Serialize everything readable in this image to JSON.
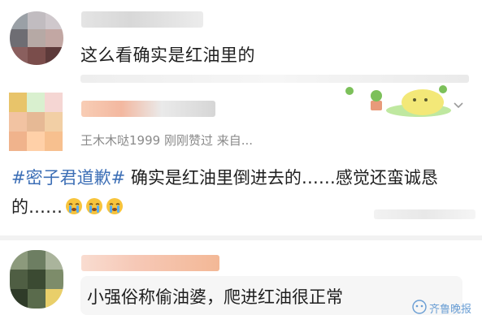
{
  "comments": [
    {
      "avatar_colors": [
        "#9aa0a6",
        "#c1bcc0",
        "#cfc8cc",
        "#6e6d73",
        "#b6a9a5",
        "#c2a7a3",
        "#8a5f5e",
        "#7a4d4b",
        "#5d3a3a"
      ],
      "text": "这么看确实是红油里的"
    },
    {
      "avatar_colors": [
        "#e8c46a",
        "#d9f0cf",
        "#f5d6d3",
        "#f2c3a2",
        "#e6b995",
        "#f2cfa5",
        "#f0b38c",
        "#ffd0a8",
        "#f7c08f"
      ],
      "user_line": "王木木哒1999  刚刚赞过  来自...",
      "hashtag": "#密子君道歉#",
      "body": " 确实是红油里倒进去的……感觉还蛮诚恳的……",
      "emoji_names": [
        "crying-face-icon",
        "crying-face-icon",
        "crying-face-icon"
      ]
    },
    {
      "avatar_colors": [
        "#8c9a7c",
        "#6d7e62",
        "#aab49c",
        "#4f5e43",
        "#3b4a32",
        "#7d8c6a",
        "#2f3b29",
        "#5a6b4c",
        "#e9cf6a"
      ],
      "text": "小强俗称偷油婆，爬进红油很正常"
    }
  ],
  "watermark": {
    "text": "齐鲁晚报",
    "color": "#6a9ed4"
  },
  "colors": {
    "hashtag": "#3d6fb6",
    "body_text": "#1f1f1f",
    "meta_text": "#8a8a8a"
  }
}
